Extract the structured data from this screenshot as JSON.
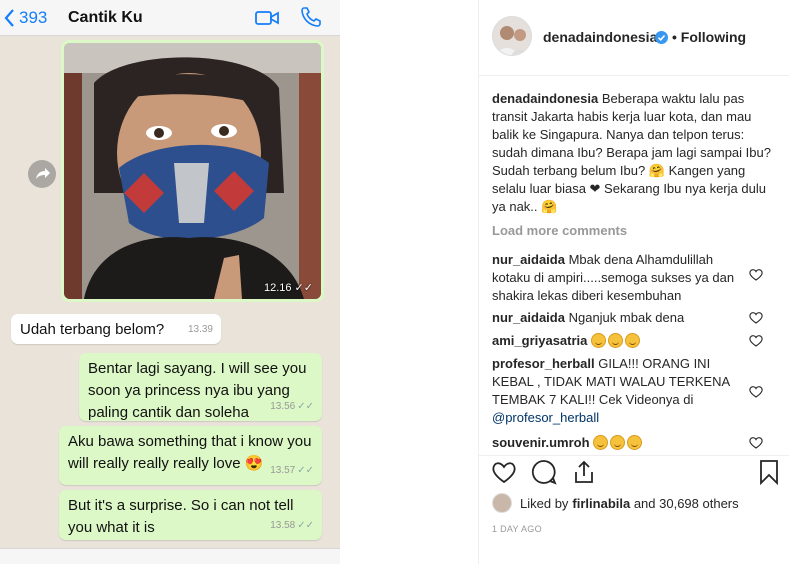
{
  "whatsapp": {
    "back_count": "393",
    "contact_name": "Cantik Ku",
    "image_time": "12.16",
    "messages": [
      {
        "text": "Udah terbang belom?",
        "time": "13.39",
        "dir": "in"
      },
      {
        "text": "Bentar lagi sayang. I will see you soon ya princess nya ibu yang paling cantik dan soleha",
        "time": "13.56",
        "dir": "out"
      },
      {
        "text": "Aku bawa something that i know you will really really really love 😍",
        "time": "13.57",
        "dir": "out"
      },
      {
        "text": "But it's a surprise. So i can not tell you what it is",
        "time": "13.58",
        "dir": "out"
      }
    ]
  },
  "instagram": {
    "username": "denadaindonesia",
    "follow_status": "• Following",
    "caption_user": "denadaindonesia",
    "caption": "Beberapa waktu lalu pas transit Jakarta habis kerja luar kota, dan mau balik ke Singapura. Nanya dan telpon terus: sudah dimana Ibu? Berapa jam lagi sampai Ibu? Sudah terbang belum Ibu? 🤗 Kangen yang selalu luar biasa ❤ Sekarang Ibu nya kerja dulu ya nak.. 🤗",
    "load_more": "Load more comments",
    "comments": [
      {
        "user": "nur_aidaida",
        "text": "Mbak dena Alhamdulillah kotaku di ampiri.....semoga sukses ya dan shakira lekas diberi kesembuhan"
      },
      {
        "user": "nur_aidaida",
        "text": "Nganjuk mbak dena"
      },
      {
        "user": "ami_griyasatria",
        "text": ""
      },
      {
        "user": "profesor_herball",
        "text": "GILA!!! ORANG INI KEBAL , TIDAK MATI WALAU TERKENA TEMBAK 7 KALI!! Cek Videonya di",
        "link": "@profesor_herball"
      },
      {
        "user": "souvenir.umroh",
        "text": ""
      }
    ],
    "liked_by_prefix": "Liked by ",
    "liked_by_user": "firlinabila",
    "liked_by_suffix": " and 30,698 others",
    "time_ago": "1 DAY AGO"
  },
  "colors": {
    "wa_bg": "#e9e3da",
    "wa_out": "#dcf8c6",
    "ig_blue": "#3897f0",
    "wa_blue": "#147efb"
  }
}
